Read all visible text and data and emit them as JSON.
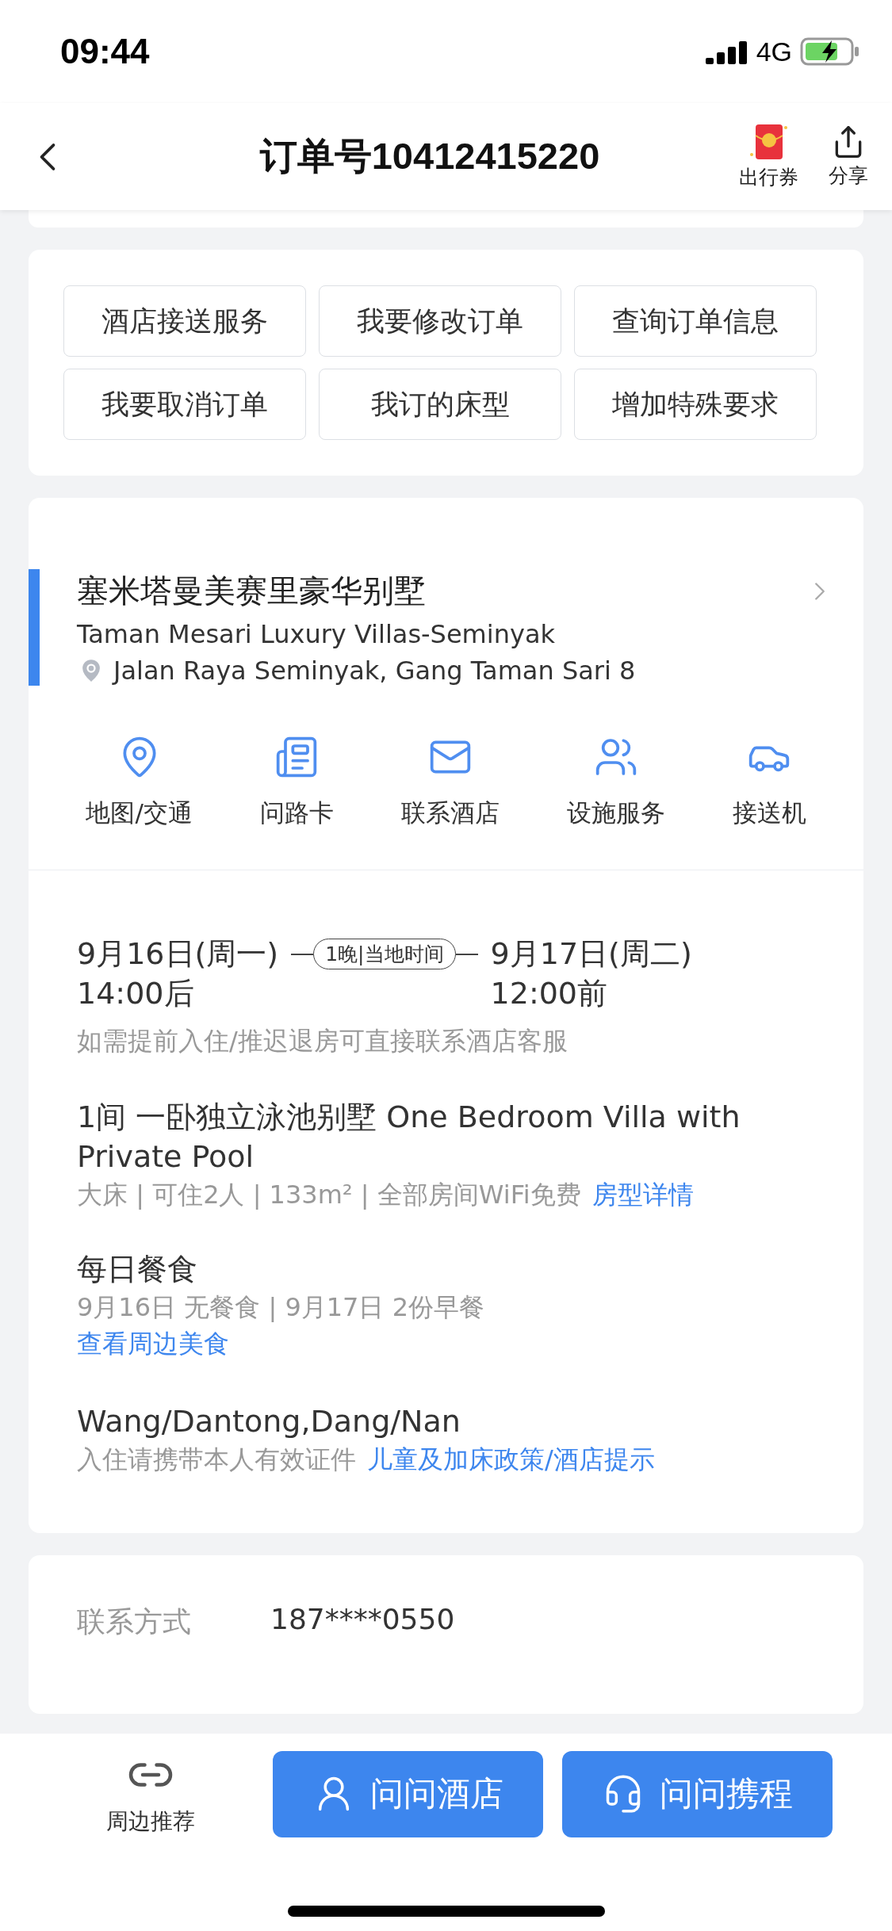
{
  "status_bar": {
    "time": "09:44",
    "network": "4G"
  },
  "header": {
    "title": "订单号10412415220",
    "actions": [
      {
        "kind": "coupon",
        "label": "出行券"
      },
      {
        "kind": "share",
        "label": "分享"
      }
    ]
  },
  "quick_actions": [
    "酒店接送服务",
    "我要修改订单",
    "查询订单信息",
    "我要取消订单",
    "我订的床型",
    "增加特殊要求"
  ],
  "hotel": {
    "name": "塞米塔曼美赛里豪华别墅",
    "name_en": "Taman Mesari Luxury Villas-Seminyak",
    "address": "Jalan Raya Seminyak, Gang Taman Sari 8"
  },
  "services": [
    {
      "kind": "map",
      "label": "地图/交通"
    },
    {
      "kind": "card",
      "label": "问路卡"
    },
    {
      "kind": "contact",
      "label": "联系酒店"
    },
    {
      "kind": "facility",
      "label": "设施服务"
    },
    {
      "kind": "car",
      "label": "接送机"
    }
  ],
  "stay": {
    "checkin_date": "9月16日(周一)",
    "checkin_time": "14:00后",
    "nights": "1晚|当地时间",
    "checkout_date": "9月17日(周二)",
    "checkout_time": "12:00前",
    "note": "如需提前入住/推迟退房可直接联系酒店客服"
  },
  "room": {
    "title": "1间 一卧独立泳池别墅 One Bedroom Villa with Private Pool",
    "details": "大床 | 可住2人 | 133m² | 全部房间WiFi免费",
    "link": "房型详情"
  },
  "meals": {
    "title": "每日餐食",
    "details": "9月16日 无餐食 | 9月17日 2份早餐",
    "link": "查看周边美食"
  },
  "guests": {
    "names": "Wang/Dantong,Dang/Nan",
    "note": "入住请携带本人有效证件",
    "link": "儿童及加床政策/酒店提示"
  },
  "contact": {
    "label": "联系方式",
    "value": "187****0550"
  },
  "bottom_bar": {
    "recommend": "周边推荐",
    "buttons": [
      {
        "kind": "hotel",
        "label": "问问酒店"
      },
      {
        "kind": "support",
        "label": "问问携程"
      }
    ]
  }
}
